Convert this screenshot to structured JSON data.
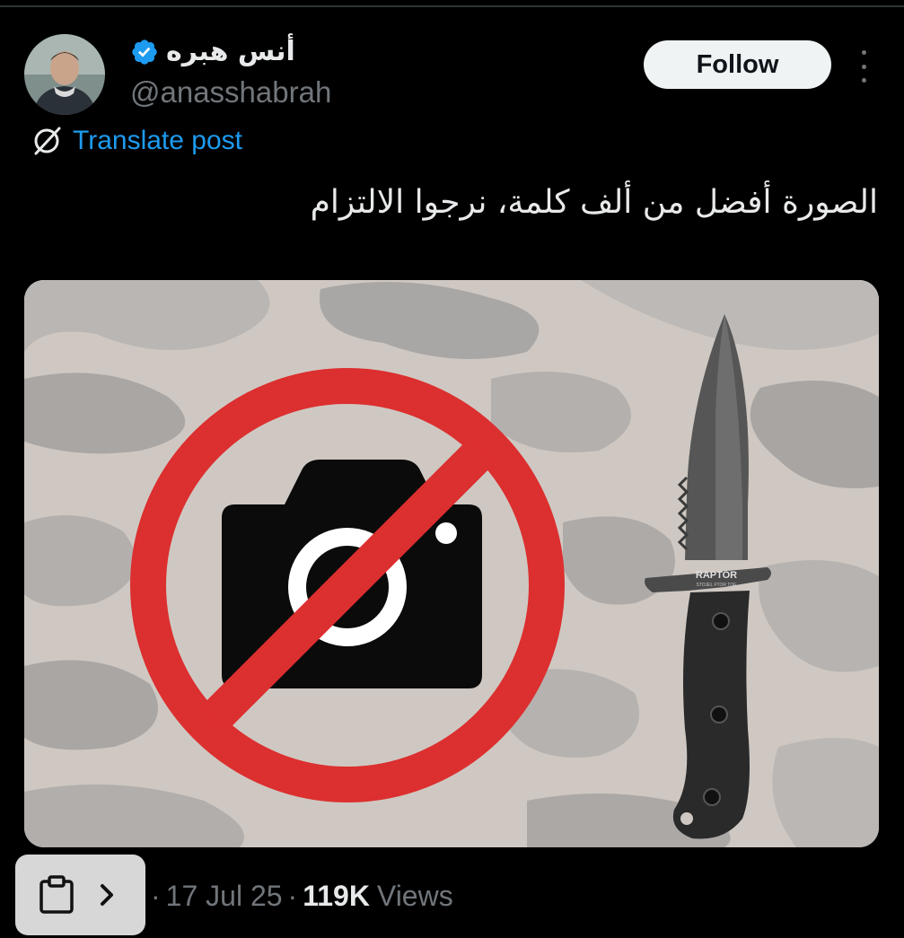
{
  "post": {
    "author": {
      "display_name": "أنس هبره",
      "handle": "@anasshabrah",
      "verified": true,
      "verified_color": "#1d9bf0"
    },
    "follow_label": "Follow",
    "translate_label": "Translate post",
    "text": "الصورة أفضل من ألف كلمة، نرجوا الالتزام",
    "media": {
      "knife_brand": "RAPTOR",
      "knife_subtext": "STOJEL FTOR TOE",
      "prohibition_color": "#dc2f2f"
    },
    "meta": {
      "separator": "·",
      "date": "17 Jul 25",
      "views_count": "119K",
      "views_label": "Views"
    }
  },
  "icons": {
    "verified": "verified-badge-icon",
    "more": "more-dots-icon",
    "translate": "globe-slash-icon",
    "clipboard": "clipboard-icon",
    "chevron": "chevron-right-icon"
  }
}
